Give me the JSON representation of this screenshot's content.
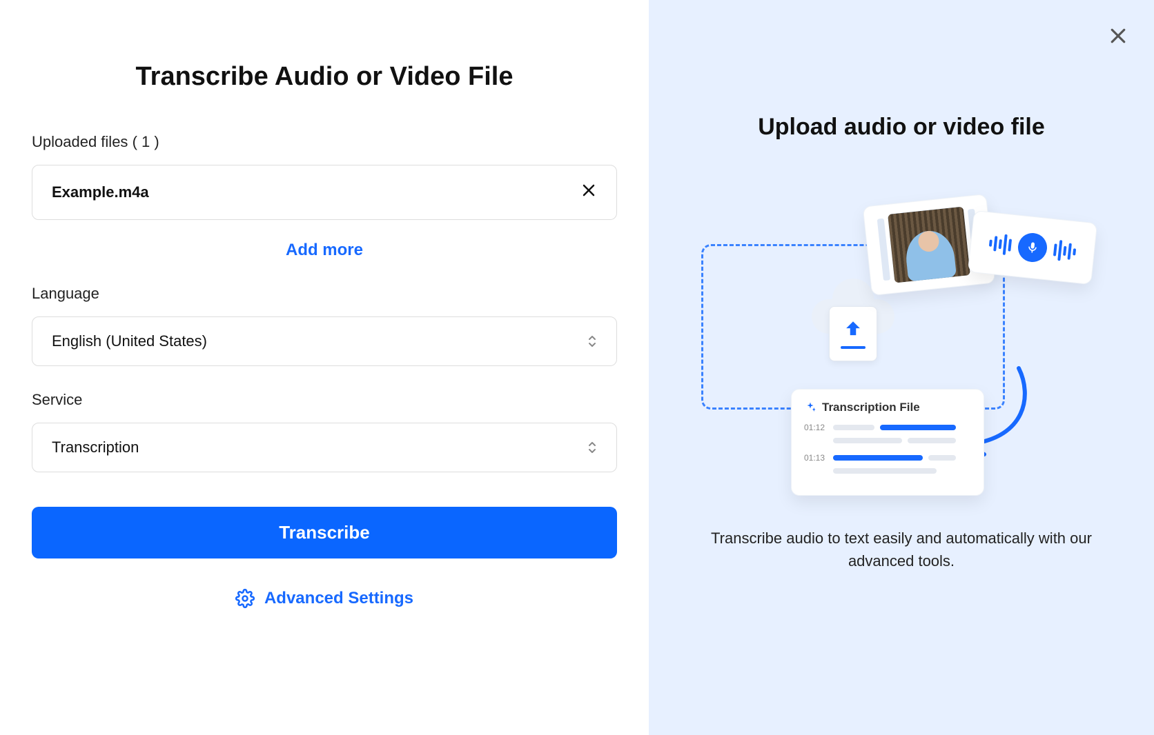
{
  "left": {
    "title": "Transcribe Audio or Video File",
    "uploaded_label_prefix": "Uploaded files",
    "uploaded_count": "( 1 )",
    "file_name": "Example.m4a",
    "add_more": "Add more",
    "language_label": "Language",
    "language_value": "English (United States)",
    "service_label": "Service",
    "service_value": "Transcription",
    "transcribe_btn": "Transcribe",
    "advanced_settings": "Advanced Settings"
  },
  "right": {
    "title": "Upload audio or video file",
    "description": "Transcribe audio to text easily and automatically with our advanced tools.",
    "trans_card_title": "Transcription File",
    "trans_time_1": "01:12",
    "trans_time_2": "01:13"
  }
}
